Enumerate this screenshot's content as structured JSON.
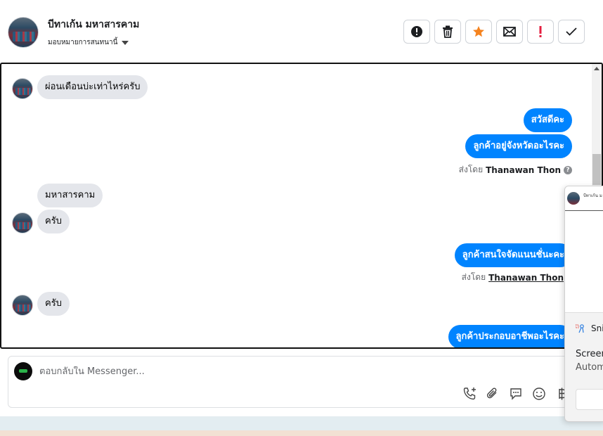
{
  "header": {
    "contact_name": "บีทาเก้น มหาสารคาม",
    "assign_label": "มอบหมายการสนทนานี้",
    "actions": [
      {
        "name": "mark-spam-button",
        "icon": "alert-circle-icon"
      },
      {
        "name": "delete-button",
        "icon": "trash-icon"
      },
      {
        "name": "star-button",
        "icon": "star-icon"
      },
      {
        "name": "mark-unread-button",
        "icon": "envelope-icon"
      },
      {
        "name": "important-button",
        "icon": "exclamation-icon"
      },
      {
        "name": "done-button",
        "icon": "check-icon"
      }
    ]
  },
  "messages": [
    {
      "side": "in",
      "text": "ผ่อนเดือนบ่ะเท่าไหร่ครับ"
    },
    {
      "side": "out",
      "text": "สวัสดีคะ"
    },
    {
      "side": "out",
      "text": "ลูกค้าอยู่จังหวัดอะไรคะ"
    },
    {
      "sent_by_prefix": "ส่งโดย",
      "sent_by_name": "Thanawan Thon"
    },
    {
      "side": "in",
      "text": "มหาสารคาม"
    },
    {
      "side": "in",
      "text": "ครับ"
    },
    {
      "side": "out",
      "text": "ลูกค้าสนใจจัดแนนชั่นะคะ"
    },
    {
      "sent_by_prefix": "ส่งโดย",
      "sent_by_name": "Thanawan Thon"
    },
    {
      "side": "in",
      "text": "ครับ"
    },
    {
      "side": "out",
      "text": "ลูกค้าประกอบอาชีพอะไรคะ"
    }
  ],
  "reply": {
    "placeholder": "ตอบกลับใน Messenger..."
  },
  "snip_popup": {
    "thumb_title": "บีทาเก้น ม",
    "app_name": "Sni",
    "title": "Screen",
    "subtitle": "Autom"
  },
  "colors": {
    "accent": "#0084ff",
    "incoming_bubble": "#e4e6eb",
    "star": "#f5831f",
    "important": "#e41e3f"
  }
}
